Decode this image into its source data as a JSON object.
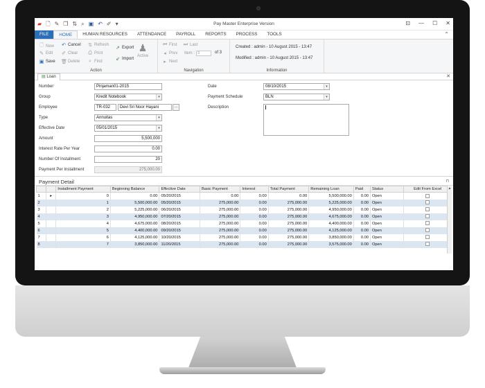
{
  "window": {
    "title": "Pay Master Enterprise Version",
    "controls": [
      "⊡",
      "—",
      "☐",
      "✕"
    ]
  },
  "menu_tabs": [
    "FILE",
    "HOME",
    "HUMAN RESOURCES",
    "ATTENDANCE",
    "PAYROLL",
    "REPORTS",
    "PROCESS",
    "TOOLS"
  ],
  "ribbon": {
    "action": {
      "label": "Action",
      "new": "New",
      "edit": "Edit",
      "save": "Save",
      "cancel": "Cancel",
      "clear": "Clear",
      "delete": "Delete",
      "refresh": "Refresh",
      "print": "Print",
      "find": "Find",
      "export": "Export",
      "import": "Import",
      "active": "Active"
    },
    "navigation": {
      "label": "Navigation",
      "first": "First",
      "last": "Last",
      "prev": "Prev",
      "next": "Next",
      "item_label": "Item :",
      "item_value": "3",
      "of": "of 3"
    },
    "information": {
      "label": "Information",
      "created": "Created : admin - 10 August 2015 - 13:47",
      "modified": "Modified : admin - 10 August 2015 - 13:47"
    }
  },
  "doc_tab": "Loan",
  "form": {
    "number": {
      "label": "Number",
      "value": "Pinjaman01-2015"
    },
    "group": {
      "label": "Group",
      "value": "Kredit Notebook"
    },
    "employee": {
      "label": "Employee",
      "code": "TR-032",
      "name": "Devi Sri Noor Hayani"
    },
    "type": {
      "label": "Type",
      "value": "Annuitas"
    },
    "effective_date": {
      "label": "Effective Date",
      "value": "05/01/2015"
    },
    "amount": {
      "label": "Amount",
      "value": "5,500,000"
    },
    "interest_rate": {
      "label": "Interest Rate Per Year",
      "value": "0.00"
    },
    "installments": {
      "label": "Number Of Installment",
      "value": "20"
    },
    "payment_per_installment": {
      "label": "Payment Per Installment",
      "value": "275,000.00"
    },
    "date": {
      "label": "Date",
      "value": "08/10/2015"
    },
    "payment_schedule": {
      "label": "Payment Schedule",
      "value": "BLN"
    },
    "description": {
      "label": "Description",
      "value": ""
    }
  },
  "detail": {
    "title": "Payment Detail",
    "columns": [
      "",
      "Installment Payment",
      "Beginning Balance",
      "Effective Date",
      "Basic Payment",
      "Interest",
      "Total Payment",
      "Remaining Loan",
      "Paid",
      "Status",
      "Edit From Excel"
    ],
    "rows": [
      {
        "n": "1",
        "marker": "▸",
        "inst": "0",
        "begin": "0.00",
        "date": "05/20/2015",
        "basic": "0.00",
        "interest": "0.00",
        "total": "0.00",
        "remaining": "5,500,000.00",
        "paid": "0.00",
        "status": "Open"
      },
      {
        "n": "2",
        "marker": "",
        "inst": "1",
        "begin": "5,500,000.00",
        "date": "05/20/2015",
        "basic": "275,000.00",
        "interest": "0.00",
        "total": "275,000.00",
        "remaining": "5,225,000.00",
        "paid": "0.00",
        "status": "Open"
      },
      {
        "n": "3",
        "marker": "",
        "inst": "2",
        "begin": "5,225,000.00",
        "date": "06/20/2015",
        "basic": "275,000.00",
        "interest": "0.00",
        "total": "275,000.00",
        "remaining": "4,950,000.00",
        "paid": "0.00",
        "status": "Open"
      },
      {
        "n": "4",
        "marker": "",
        "inst": "3",
        "begin": "4,950,000.00",
        "date": "07/20/2015",
        "basic": "275,000.00",
        "interest": "0.00",
        "total": "275,000.00",
        "remaining": "4,675,000.00",
        "paid": "0.00",
        "status": "Open"
      },
      {
        "n": "5",
        "marker": "",
        "inst": "4",
        "begin": "4,675,000.00",
        "date": "08/20/2015",
        "basic": "275,000.00",
        "interest": "0.00",
        "total": "275,000.00",
        "remaining": "4,400,000.00",
        "paid": "0.00",
        "status": "Open"
      },
      {
        "n": "6",
        "marker": "",
        "inst": "5",
        "begin": "4,400,000.00",
        "date": "09/20/2015",
        "basic": "275,000.00",
        "interest": "0.00",
        "total": "275,000.00",
        "remaining": "4,125,000.00",
        "paid": "0.00",
        "status": "Open"
      },
      {
        "n": "7",
        "marker": "",
        "inst": "6",
        "begin": "4,125,000.00",
        "date": "10/20/2015",
        "basic": "275,000.00",
        "interest": "0.00",
        "total": "275,000.00",
        "remaining": "3,850,000.00",
        "paid": "0.00",
        "status": "Open"
      },
      {
        "n": "8",
        "marker": "",
        "inst": "7",
        "begin": "3,850,000.00",
        "date": "11/20/2015",
        "basic": "275,000.00",
        "interest": "0.00",
        "total": "275,000.00",
        "remaining": "3,575,000.00",
        "paid": "0.00",
        "status": "Open"
      }
    ]
  }
}
